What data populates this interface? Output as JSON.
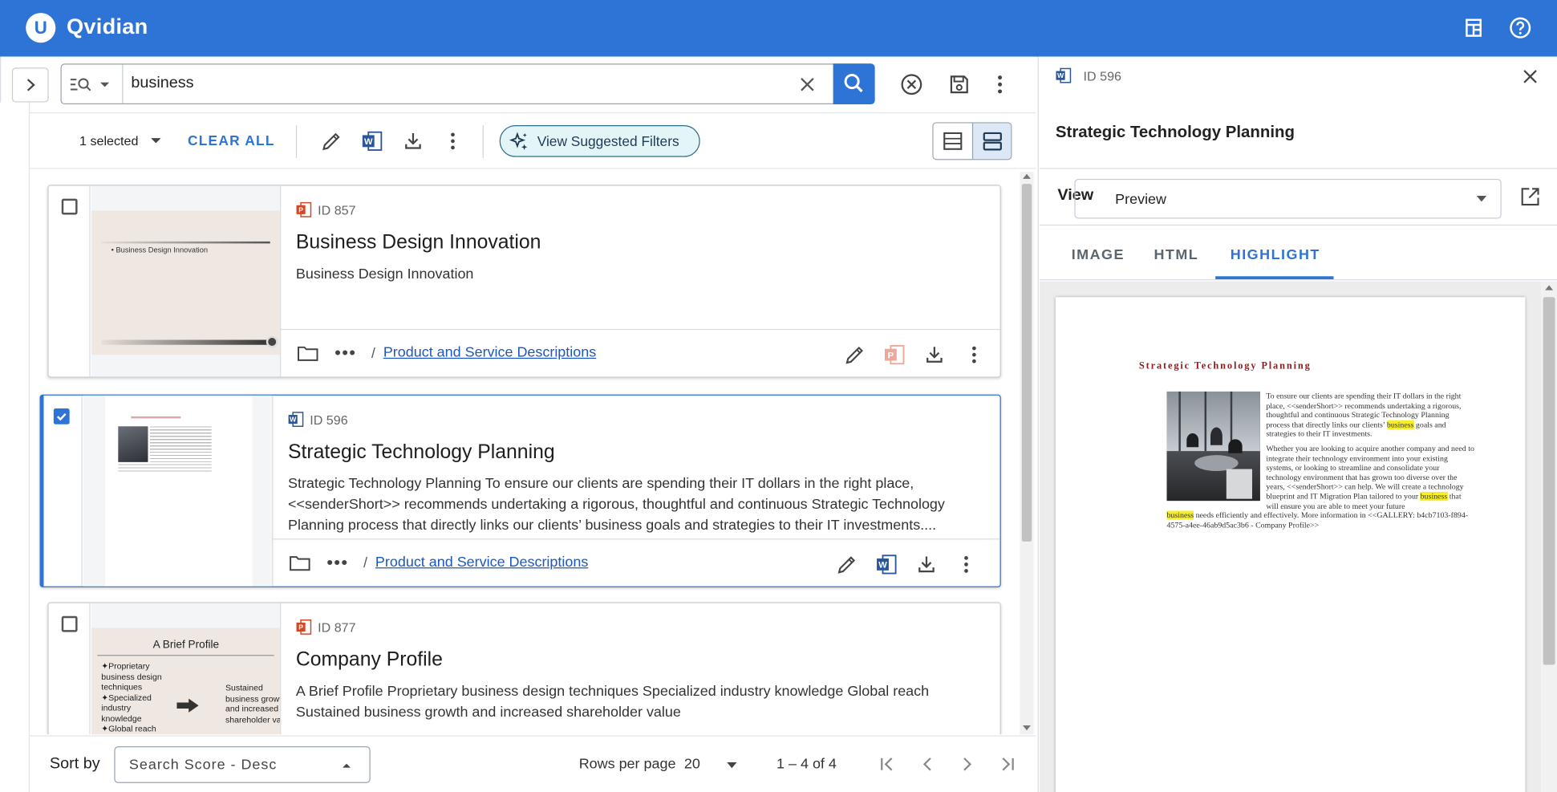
{
  "app": {
    "brand": "Qvidian",
    "logo_letter": "U"
  },
  "search": {
    "value": "business"
  },
  "toolbar": {
    "selected_text": "1 selected",
    "clear_all": "CLEAR ALL",
    "suggested_filters": "View Suggested Filters"
  },
  "results": [
    {
      "id": "ID 857",
      "title": "Business Design Innovation",
      "snippet": "Business Design Innovation",
      "path": "Product and Service Descriptions",
      "file_type": "powerpoint",
      "selected": false,
      "thumb_text": "Business Design Innovation"
    },
    {
      "id": "ID 596",
      "title": "Strategic Technology Planning",
      "snippet": "Strategic Technology Planning To ensure our clients are spending their IT dollars in the right place, <<senderShort>> recommends undertaking a rigorous, thoughtful and continuous Strategic Technology Planning process that directly links our clients’ business goals and strategies to their IT investments....",
      "path": "Product and Service Descriptions",
      "file_type": "word",
      "selected": true
    },
    {
      "id": "ID 877",
      "title": "Company Profile",
      "snippet": "A Brief Profile Proprietary business design techniques Specialized industry knowledge Global reach Sustained business growth and increased shareholder value",
      "path": "",
      "file_type": "powerpoint",
      "selected": false,
      "thumb_title": "A Brief Profile",
      "thumb_bullets": [
        "Proprietary business design techniques",
        "Specialized industry knowledge",
        "Global reach"
      ],
      "thumb_right": "Sustained business growth and increased shareholder value"
    }
  ],
  "footer": {
    "sort_label": "Sort by",
    "sort_value": "Search Score - Desc",
    "rows_label": "Rows per page",
    "rows_value": "20",
    "range": "1 – 4 of 4"
  },
  "preview": {
    "id": "ID 596",
    "title": "Strategic Technology Planning",
    "view_label": "View",
    "view_value": "Preview",
    "tabs": [
      "IMAGE",
      "HTML",
      "HIGHLIGHT"
    ],
    "active_tab": "HIGHLIGHT",
    "doc_title": "Strategic Technology Planning",
    "para1_a": "To ensure our clients are spending their IT dollars in the right place, <<senderShort>> recommends undertaking a rigorous, thoughtful and continuous Strategic Technology Planning process that directly links our clients’ ",
    "hl1": "business",
    "para1_b": " goals and strategies to their IT investments.",
    "para2_a": "Whether you are looking to acquire another company and need to integrate their technology environment into your existing systems, or looking to streamline and consolidate your technology environment that has grown too diverse over the years, <<senderShort>> can help. We will create a technology blueprint and IT Migration Plan tailored to your ",
    "hl2": "business",
    "para2_b": " that will ensure you are able to meet your future",
    "hl3": "business",
    "para3": " needs efficiently and effectively. More information in <<GALLERY: b4cb7103-f894-4575-a4ee-46ab9d5ac3b6 - Company Profile>>"
  },
  "colors": {
    "primary": "#2d74d6",
    "highlight": "#f5ee28",
    "ppt": "#d24726",
    "word": "#2b579a"
  }
}
